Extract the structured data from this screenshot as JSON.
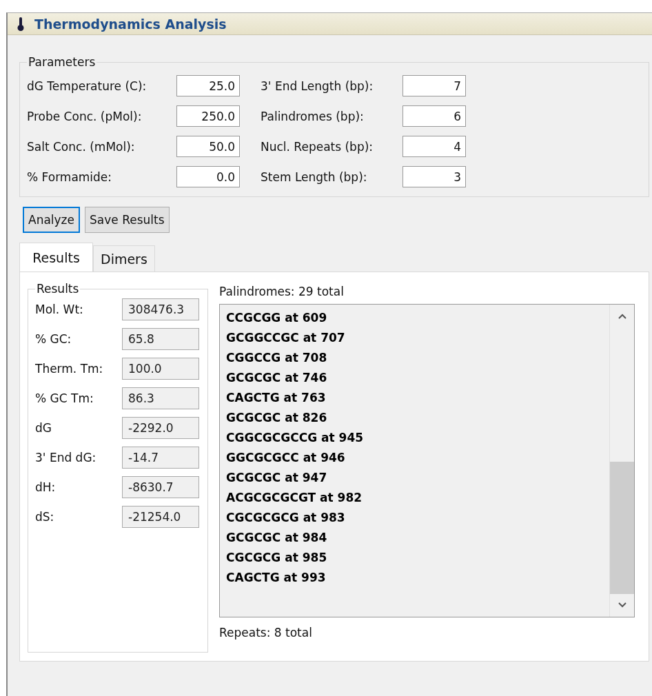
{
  "window": {
    "title": "Thermodynamics Analysis"
  },
  "parameters": {
    "title": "Parameters",
    "fields": [
      {
        "label": "dG Temperature (C):",
        "value": "25.0"
      },
      {
        "label": "3' End Length (bp):",
        "value": "7"
      },
      {
        "label": "Probe Conc. (pMol):",
        "value": "250.0"
      },
      {
        "label": "Palindromes (bp):",
        "value": "6"
      },
      {
        "label": "Salt Conc. (mMol):",
        "value": "50.0"
      },
      {
        "label": "Nucl. Repeats (bp):",
        "value": "4"
      },
      {
        "label": "% Formamide:",
        "value": "0.0"
      },
      {
        "label": "Stem Length (bp):",
        "value": "3"
      }
    ]
  },
  "buttons": [
    {
      "label": "Analyze",
      "focused": true
    },
    {
      "label": "Save Results",
      "focused": false
    }
  ],
  "tabs": [
    {
      "label": "Results",
      "selected": true
    },
    {
      "label": "Dimers",
      "selected": false
    }
  ],
  "results": {
    "title": "Results",
    "fields": [
      {
        "label": "Mol. Wt:",
        "value": "308476.3"
      },
      {
        "label": "% GC:",
        "value": "65.8"
      },
      {
        "label": "Therm. Tm:",
        "value": "100.0"
      },
      {
        "label": "% GC Tm:",
        "value": "86.3"
      },
      {
        "label": "dG",
        "value": "-2292.0"
      },
      {
        "label": "3' End dG:",
        "value": "-14.7"
      },
      {
        "label": "dH:",
        "value": "-8630.7"
      },
      {
        "label": "dS:",
        "value": "-21254.0"
      }
    ]
  },
  "palindromes": {
    "heading": "Palindromes: 29 total",
    "items": [
      "CCGCGG at 609",
      "GCGGCCGC at 707",
      "CGGCCG at 708",
      "GCGCGC at 746",
      "CAGCTG at 763",
      "GCGCGC at 826",
      "CGGCGCGCCG at 945",
      "GGCGCGCC at 946",
      "GCGCGC at 947",
      "ACGCGCGCGT at 982",
      "CGCGCGCG at 983",
      "GCGCGC at 984",
      "CGCGCG at 985",
      "CAGCTG at 993"
    ]
  },
  "repeats": {
    "heading": "Repeats: 8 total"
  }
}
